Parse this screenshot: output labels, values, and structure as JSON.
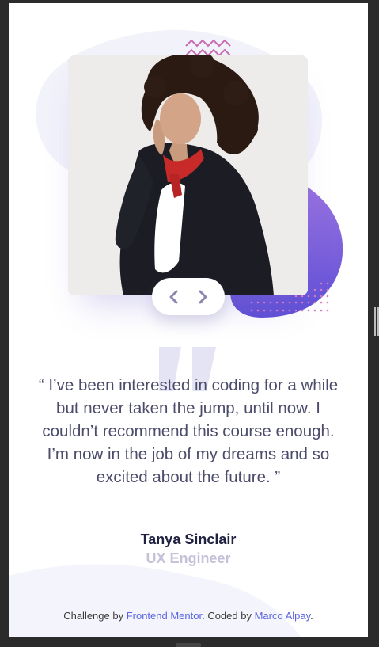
{
  "testimonial": {
    "quote": "“ I’ve been interested in coding for a while but never taken the jump, until now. I couldn’t recommend this course enough. I’m now in the job of my dreams and so excited about the future. ”",
    "name": "Tanya Sinclair",
    "role": "UX Engineer"
  },
  "navigation": {
    "prev_icon": "chevron-left-icon",
    "next_icon": "chevron-right-icon"
  },
  "footer": {
    "prefix": "Challenge by ",
    "link1": "Frontend Mentor",
    "middle": ". Coded by ",
    "link2": "Marco Alpay",
    "suffix": "."
  },
  "colors": {
    "accent": "#5964e0",
    "purple_blob": "#7e58d8",
    "dark_text": "#202040",
    "muted_text": "#c4c2d8",
    "body_text": "#4b4b6b",
    "zigzag": "#c96bb0",
    "dots": "#d07bc4"
  }
}
